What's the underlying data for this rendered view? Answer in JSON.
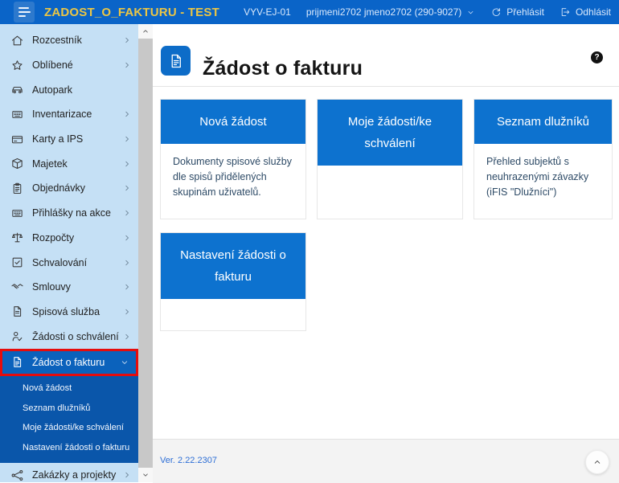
{
  "topbar": {
    "app_title": "ZADOST_O_FAKTURU - TEST",
    "environment": "VYV-EJ-01",
    "user": "prijmeni2702 jmeno2702 (290-9027)",
    "relogin_label": "Přehlásit",
    "logout_label": "Odhlásit",
    "menu_icon": "hamburger-icon",
    "user_chevron_icon": "chevron-down-icon",
    "relogin_icon": "refresh-icon",
    "logout_icon": "logout-icon"
  },
  "sidebar": {
    "items": [
      {
        "label": "Rozcestník",
        "icon": "home-icon",
        "chevron": "right"
      },
      {
        "label": "Oblíbené",
        "icon": "star-icon",
        "chevron": "right"
      },
      {
        "label": "Autopark",
        "icon": "car-icon",
        "chevron": ""
      },
      {
        "label": "Inventarizace",
        "icon": "grid-icon",
        "chevron": "right"
      },
      {
        "label": "Karty a IPS",
        "icon": "card-icon",
        "chevron": "right"
      },
      {
        "label": "Majetek",
        "icon": "box-icon",
        "chevron": "right"
      },
      {
        "label": "Objednávky",
        "icon": "clipboard-icon",
        "chevron": "right"
      },
      {
        "label": "Přihlášky na akce",
        "icon": "keyboard-icon",
        "chevron": "right"
      },
      {
        "label": "Rozpočty",
        "icon": "scales-icon",
        "chevron": "right"
      },
      {
        "label": "Schvalování",
        "icon": "checkbox-icon",
        "chevron": "right"
      },
      {
        "label": "Smlouvy",
        "icon": "handshake-icon",
        "chevron": "right"
      },
      {
        "label": "Spisová služba",
        "icon": "document-icon",
        "chevron": "right"
      },
      {
        "label": "Žádosti o schválení",
        "icon": "person-check-icon",
        "chevron": "right"
      },
      {
        "label": "Žádost o fakturu",
        "icon": "invoice-icon",
        "chevron": "down",
        "active": true
      }
    ],
    "submenu": [
      {
        "label": "Nová žádost"
      },
      {
        "label": "Seznam dlužníků"
      },
      {
        "label": "Moje žádosti/ke schválení"
      },
      {
        "label": "Nastavení žádosti o fakturu"
      }
    ],
    "bottom_item": {
      "label": "Zakázky a projekty",
      "icon": "projects-icon",
      "chevron": "right"
    }
  },
  "page": {
    "title": "Žádost o fakturu",
    "title_icon": "invoice-icon",
    "help_label": "?",
    "cards": [
      {
        "title": "Nová žádost",
        "description": "Dokumenty spisové služby dle spisů přidělených skupinám uživatelů."
      },
      {
        "title": "Moje žádosti/ke schválení",
        "description": ""
      },
      {
        "title": "Seznam dlužníků",
        "description": "Přehled subjektů s neuhrazenými závazky (iFIS \"Dlužníci\")"
      },
      {
        "title": "Nastavení žádosti o fakturu",
        "description": ""
      }
    ]
  },
  "footer": {
    "version": "Ver. 2.22.2307",
    "scroll_top_icon": "chevron-up-icon"
  },
  "colors": {
    "topbar_bg": "#0a64c8",
    "topbar_title": "#ecc644",
    "sidebar_bg": "#c5e0f5",
    "active_item_bg": "#0b62bc",
    "submenu_bg": "#0a56aa",
    "highlight_red": "#e60c0c",
    "card_header_bg": "#0d72cf",
    "card_body_text": "#2d4a66",
    "version_link": "#2e6fd6"
  }
}
